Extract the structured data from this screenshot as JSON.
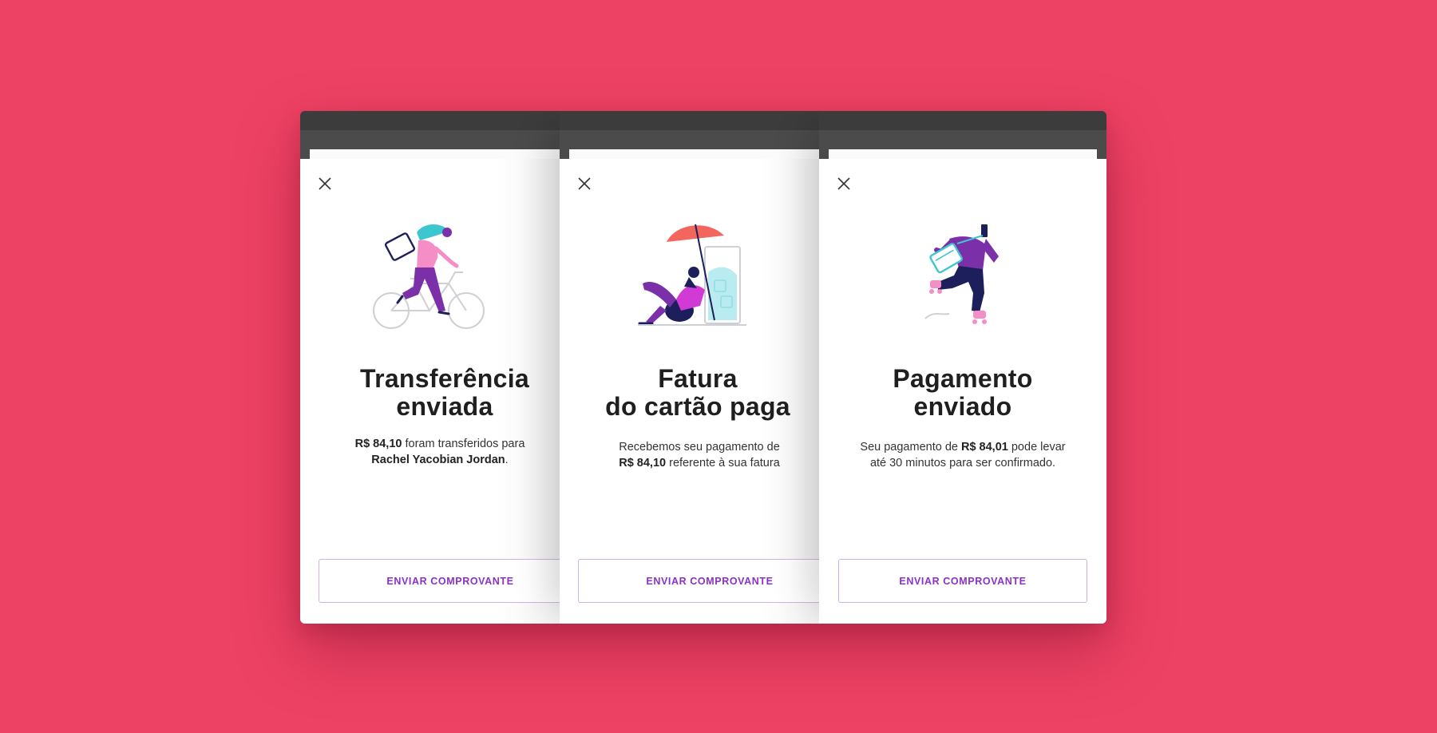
{
  "cards": [
    {
      "title_line1": "Transferência",
      "title_line2": "enviada",
      "desc": {
        "amount": "R$ 84,10",
        "text1": " foram transferidos para",
        "name": "Rachel Yacobian Jordan",
        "text2": "."
      },
      "button_label": "ENVIAR COMPROVANTE",
      "close_icon": "close-icon",
      "illustration": "person-riding-bicycle-illustration"
    },
    {
      "title_line1": "Fatura",
      "title_line2": "do cartão paga",
      "desc": {
        "text1": "Recebemos seu pagamento de",
        "amount": "R$ 84,10",
        "text2": " referente à sua fatura"
      },
      "button_label": "ENVIAR COMPROVANTE",
      "close_icon": "close-icon",
      "illustration": "person-relaxing-under-umbrella-illustration"
    },
    {
      "title_line1": "Pagamento",
      "title_line2": "enviado",
      "desc": {
        "text1": "Seu pagamento de ",
        "amount": "R$ 84,01",
        "text2": " pode levar até 30 minutos para ser confirmado."
      },
      "button_label": "ENVIAR COMPROVANTE",
      "close_icon": "close-icon",
      "illustration": "person-running-with-bag-illustration"
    }
  ],
  "colors": {
    "background": "#ee4264",
    "accent": "#8a32c6",
    "button_border": "#cdb3e6",
    "title": "#1f1f1f",
    "purple_illustration": "#7b2fa8",
    "magenta_illustration": "#d23ad6",
    "navy_illustration": "#1d1f5c",
    "teal_illustration": "#3cc6cf",
    "coral_illustration": "#f2665e"
  }
}
